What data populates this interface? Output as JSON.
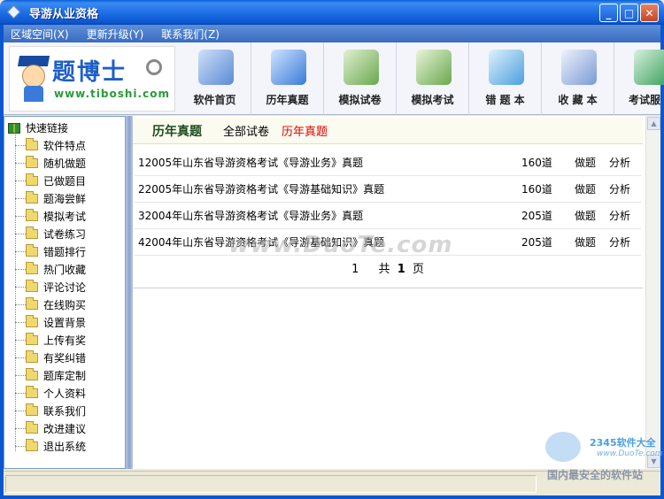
{
  "window": {
    "title": "导游从业资格",
    "minimize": "_",
    "maximize": "□",
    "close": "✕"
  },
  "menu": [
    "区域空间(X)",
    "更新升级(Y)",
    "联系我们(Z)"
  ],
  "logo": {
    "title": "题博士",
    "url": "www.tiboshi.com"
  },
  "toolbar": [
    {
      "label": "软件首页",
      "icon": "monitor-icon",
      "color": "#5a8ad6"
    },
    {
      "label": "历年真题",
      "icon": "arrows-icon",
      "color": "#3a7ad8"
    },
    {
      "label": "模拟试卷",
      "icon": "people-icon",
      "color": "#6aa84f"
    },
    {
      "label": "模拟考试",
      "icon": "person-icon",
      "color": "#6aa84f"
    },
    {
      "label": "错 题 本",
      "icon": "notebook-icon",
      "color": "#4aa0e0"
    },
    {
      "label": "收 藏 本",
      "icon": "bookmark-icon",
      "color": "#7a9ad6"
    },
    {
      "label": "考试服",
      "icon": "globe-icon",
      "color": "#3aa05a"
    }
  ],
  "sidebar": {
    "root": "快速链接",
    "items": [
      "软件特点",
      "随机做题",
      "已做题目",
      "题海尝鲜",
      "模拟考试",
      "试卷练习",
      "错题排行",
      "热门收藏",
      "评论讨论",
      "在线购买",
      "设置背景",
      "上传有奖",
      "有奖纠错",
      "题库定制",
      "个人资料",
      "联系我们",
      "改进建议",
      "退出系统"
    ]
  },
  "content": {
    "title": "历年真题",
    "filter_all": "全部试卷",
    "filter_active": "历年真题",
    "rows": [
      {
        "title": "12005年山东省导游资格考试《导游业务》真题",
        "count": "160道",
        "action1": "做题",
        "action2": "分析"
      },
      {
        "title": "22005年山东省导游资格考试《导游基础知识》真题",
        "count": "160道",
        "action1": "做题",
        "action2": "分析"
      },
      {
        "title": "32004年山东省导游资格考试《导游业务》真题",
        "count": "205道",
        "action1": "做题",
        "action2": "分析"
      },
      {
        "title": "42004年山东省导游资格考试《导游基础知识》真题",
        "count": "205道",
        "action1": "做题",
        "action2": "分析"
      }
    ],
    "pager": {
      "current": "1",
      "total_prefix": "共",
      "total": "1",
      "total_suffix": "页"
    }
  },
  "watermark": "www.DuoTe.com",
  "corner_mark": {
    "logo": "2345软件大全",
    "url": "www.DuoTe.com",
    "slogan": "国内最安全的软件站"
  }
}
